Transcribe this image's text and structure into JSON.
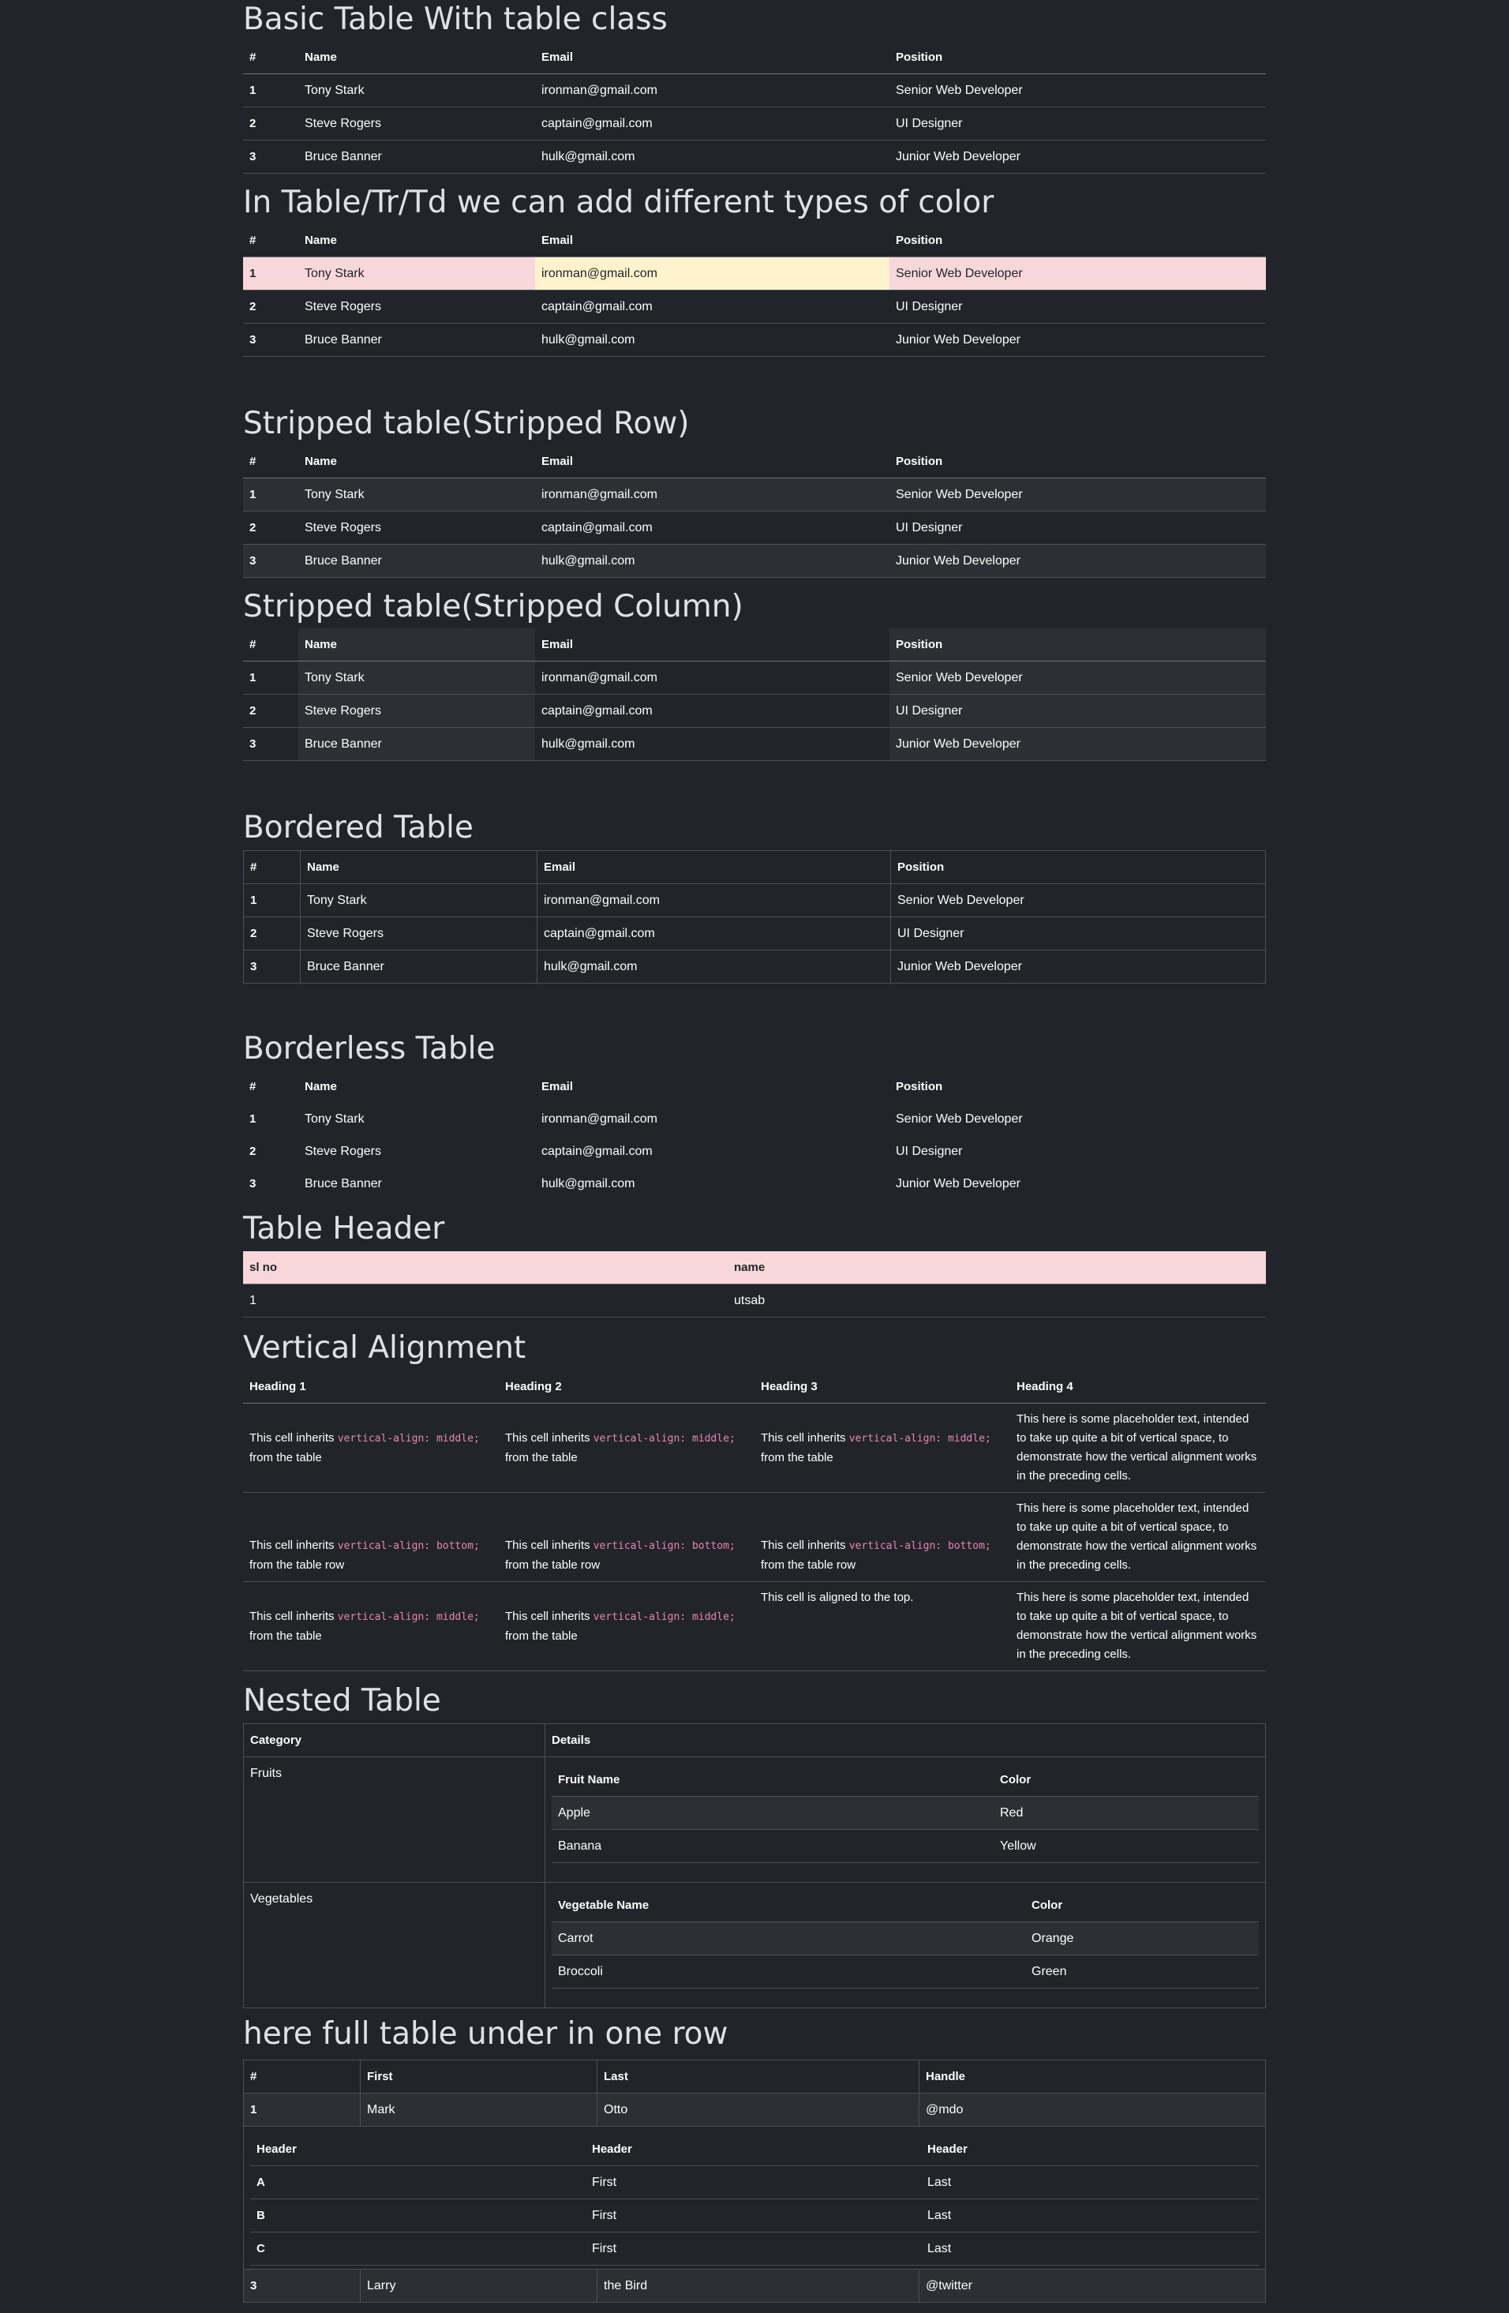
{
  "cols": {
    "num": "#",
    "name": "Name",
    "email": "Email",
    "position": "Position"
  },
  "people": [
    {
      "id": "1",
      "name": "Tony Stark",
      "email": "ironman@gmail.com",
      "position": "Senior Web Developer"
    },
    {
      "id": "2",
      "name": "Steve Rogers",
      "email": "captain@gmail.com",
      "position": "UI Designer"
    },
    {
      "id": "3",
      "name": "Bruce Banner",
      "email": "hulk@gmail.com",
      "position": "Junior Web Developer"
    }
  ],
  "titles": {
    "basic": "Basic Table With table class",
    "color": "In Table/Tr/Td we can add different types of color",
    "striped_row": "Stripped table(Stripped Row)",
    "striped_col": "Stripped table(Stripped Column)",
    "bordered": "Bordered Table",
    "borderless": "Borderless Table",
    "header": "Table Header",
    "valign": "Vertical Alignment",
    "nested": "Nested Table",
    "full": "here full table under in one row"
  },
  "header_table": {
    "col1": "sl no",
    "col2": "name",
    "row_id": "1",
    "row_name": "utsab"
  },
  "valign": {
    "headings": [
      "Heading 1",
      "Heading 2",
      "Heading 3",
      "Heading 4"
    ],
    "inherits": "This cell inherits",
    "mid_code": "vertical-align: middle;",
    "bottom_code": "vertical-align: bottom;",
    "from_table": "from the table",
    "from_row": "from the table row",
    "top_text": "This cell is aligned to the top.",
    "placeholder": "This here is some placeholder text, intended to take up quite a bit of vertical space, to demonstrate how the vertical alignment works in the preceding cells."
  },
  "nested": {
    "category": "Category",
    "details": "Details",
    "fruits": "Fruits",
    "vegetables": "Vegetables",
    "fruit_name": "Fruit Name",
    "veg_name": "Vegetable Name",
    "color": "Color",
    "fruit_rows": [
      [
        "Apple",
        "Red"
      ],
      [
        "Banana",
        "Yellow"
      ]
    ],
    "veg_rows": [
      [
        "Carrot",
        "Orange"
      ],
      [
        "Broccoli",
        "Green"
      ]
    ]
  },
  "full": {
    "headers": [
      "#",
      "First",
      "Last",
      "Handle"
    ],
    "row1": [
      "1",
      "Mark",
      "Otto",
      "@mdo"
    ],
    "inner_headers": [
      "Header",
      "Header",
      "Header"
    ],
    "inner_rows": [
      [
        "A",
        "First",
        "Last"
      ],
      [
        "B",
        "First",
        "Last"
      ],
      [
        "C",
        "First",
        "Last"
      ]
    ],
    "row3": [
      "3",
      "Larry",
      "the Bird",
      "@twitter"
    ]
  }
}
